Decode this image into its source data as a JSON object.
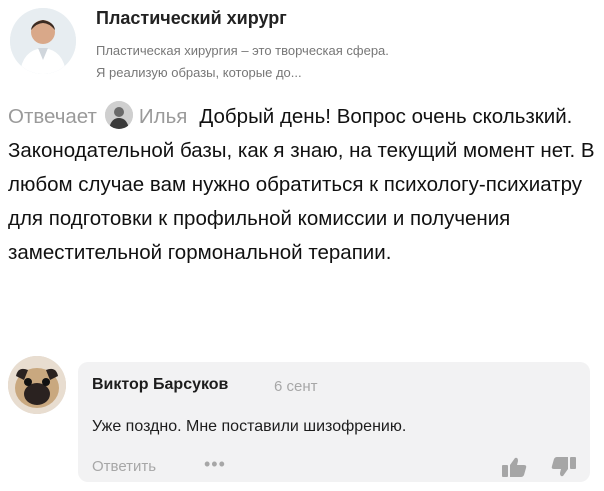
{
  "header": {
    "title": "Пластический хирург",
    "description_line1": "Пластическая хирургия – это творческая сфера.",
    "description_line2": "Я реализую образы, которые до..."
  },
  "answer": {
    "replies_label": "Отвечает",
    "author": "Илья",
    "text": "Добрый день! Вопрос очень скользкий. Законодательной базы, как я знаю, на текущий момент нет. В любом случае вам нужно обратиться к психологу-психиатру для подготовки к профильной комиссии и получения заместительной гормональной терапии."
  },
  "comment": {
    "author": "Виктор Барсуков",
    "date": "6 сент",
    "text": "Уже поздно. Мне поставили шизофрению.",
    "reply_label": "Ответить",
    "more_label": "•••"
  },
  "icons": {
    "like": "thumbs-up-icon",
    "dislike": "thumbs-down-icon"
  }
}
